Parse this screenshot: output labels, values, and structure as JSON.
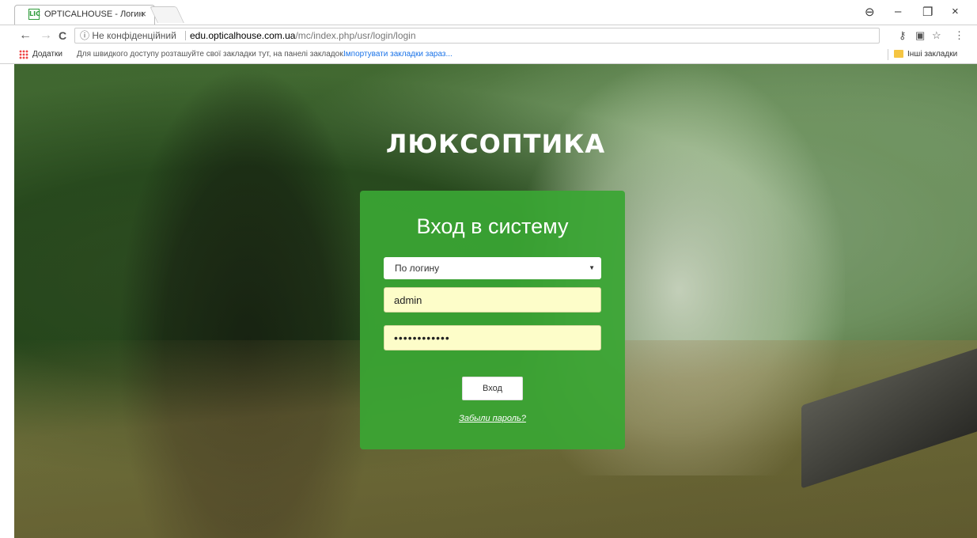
{
  "browser": {
    "tab_title": "OPTICALHOUSE - Логин",
    "favicon_text": "LIC",
    "tab_close": "×",
    "window_controls": [
      "–",
      "❐",
      "×"
    ],
    "address": {
      "security_label": "ⓘ Не конфіденційний",
      "host": "edu.opticalhouse.com.ua",
      "path": "/mc/index.php/usr/login/login"
    },
    "nav": {
      "back": "←",
      "forward": "→",
      "reload": "C"
    },
    "toolbar_icons": {
      "key": "⚷",
      "translate": "▣",
      "star": "☆",
      "menu": "⋮",
      "profile": "⊖"
    },
    "bookmarks": {
      "apps_label": "Додатки",
      "hint": "Для швидкого доступу розташуйте свої закладки тут, на панелі закладок.",
      "import_link": "Імпортувати закладки зараз...",
      "other_label": "Інші закладки"
    }
  },
  "page": {
    "logo_text": "ЛЮКСОПТИКА",
    "login": {
      "title": "Вход в систему",
      "method_selected": "По логину",
      "method_arrow": "▼",
      "login_value": "admin",
      "password_masked": "••••••••••••",
      "submit_label": "Вход",
      "forgot_link": "Забыли пароль?"
    }
  },
  "colors": {
    "card_green": "#3aa634",
    "field_bg": "#fdfdc9",
    "overlay_green": "#285f1e"
  }
}
